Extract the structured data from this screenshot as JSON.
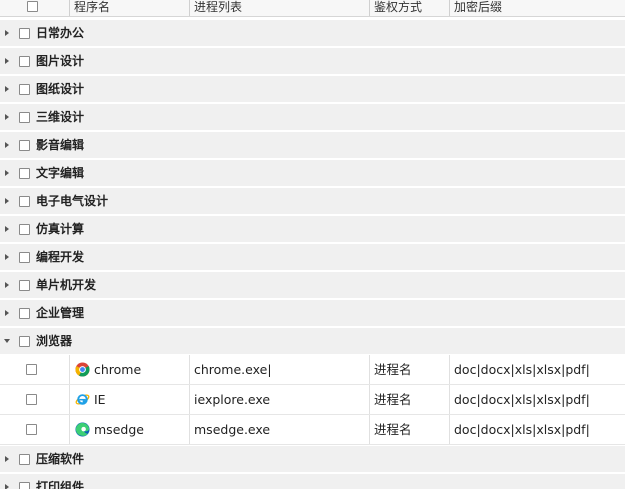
{
  "columns": {
    "name": "程序名",
    "process": "进程列表",
    "auth": "鉴权方式",
    "suffix": "加密后缀"
  },
  "groups": [
    {
      "label": "日常办公",
      "expanded": false
    },
    {
      "label": "图片设计",
      "expanded": false
    },
    {
      "label": "图纸设计",
      "expanded": false
    },
    {
      "label": "三维设计",
      "expanded": false
    },
    {
      "label": "影音编辑",
      "expanded": false
    },
    {
      "label": "文字编辑",
      "expanded": false
    },
    {
      "label": "电子电气设计",
      "expanded": false
    },
    {
      "label": "仿真计算",
      "expanded": false
    },
    {
      "label": "编程开发",
      "expanded": false
    },
    {
      "label": "单片机开发",
      "expanded": false
    },
    {
      "label": "企业管理",
      "expanded": false
    },
    {
      "label": "浏览器",
      "expanded": true
    },
    {
      "label": "压缩软件",
      "expanded": false
    },
    {
      "label": "打印组件",
      "expanded": false
    }
  ],
  "browser_items": [
    {
      "name": "chrome",
      "icon": "chrome-icon",
      "process": "chrome.exe|",
      "auth": "进程名",
      "suffix": "doc|docx|xls|xlsx|pdf|"
    },
    {
      "name": "IE",
      "icon": "ie-icon",
      "process": "iexplore.exe",
      "auth": "进程名",
      "suffix": "doc|docx|xls|xlsx|pdf|"
    },
    {
      "name": "msedge",
      "icon": "edge-icon",
      "process": "msedge.exe",
      "auth": "进程名",
      "suffix": "doc|docx|xls|xlsx|pdf|"
    }
  ]
}
